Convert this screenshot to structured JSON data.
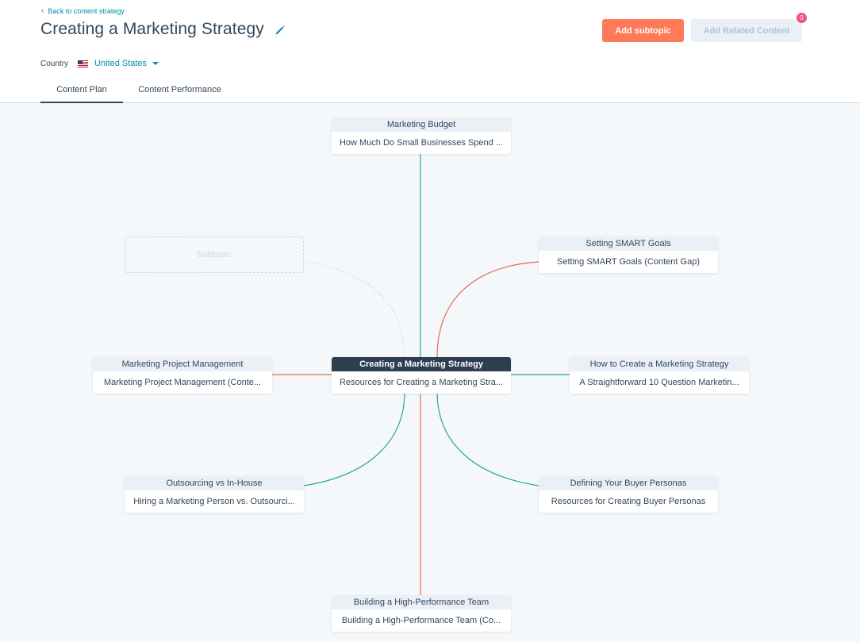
{
  "header": {
    "back_link": "Back to content strategy",
    "title": "Creating a Marketing Strategy",
    "country_label": "Country",
    "country_value": "United States",
    "add_subtopic": "Add subtopic",
    "add_related": "Add Related Content",
    "related_count": "0"
  },
  "tabs": [
    {
      "label": "Content Plan"
    },
    {
      "label": "Content Performance"
    }
  ],
  "colors": {
    "accent": "#ff7a59",
    "teal": "#00a4bd",
    "link_teal": "#27a69a",
    "link_red": "#e8685e",
    "navy": "#2d3e50"
  },
  "map": {
    "center": {
      "topic": "Creating a Marketing Strategy",
      "content": "Resources for Creating a Marketing Stra..."
    },
    "ghost": {
      "label": "Subtopic"
    },
    "nodes": [
      {
        "id": "budget",
        "topic": "Marketing Budget",
        "content": "How Much Do Small Businesses Spend ..."
      },
      {
        "id": "smart",
        "topic": "Setting SMART Goals",
        "content": "Setting SMART Goals (Content Gap)"
      },
      {
        "id": "howto",
        "topic": "How to Create a Marketing Strategy",
        "content": "A Straightforward 10 Question Marketin..."
      },
      {
        "id": "personas",
        "topic": "Defining Your Buyer Personas",
        "content": "Resources for Creating Buyer Personas"
      },
      {
        "id": "team",
        "topic": "Building a High-Performance Team",
        "content": "Building a High-Performance Team (Co..."
      },
      {
        "id": "outsourcing",
        "topic": "Outsourcing vs In-House",
        "content": "Hiring a Marketing Person vs. Outsourci..."
      },
      {
        "id": "project",
        "topic": "Marketing Project Management",
        "content": "Marketing Project Management (Conte..."
      }
    ]
  }
}
